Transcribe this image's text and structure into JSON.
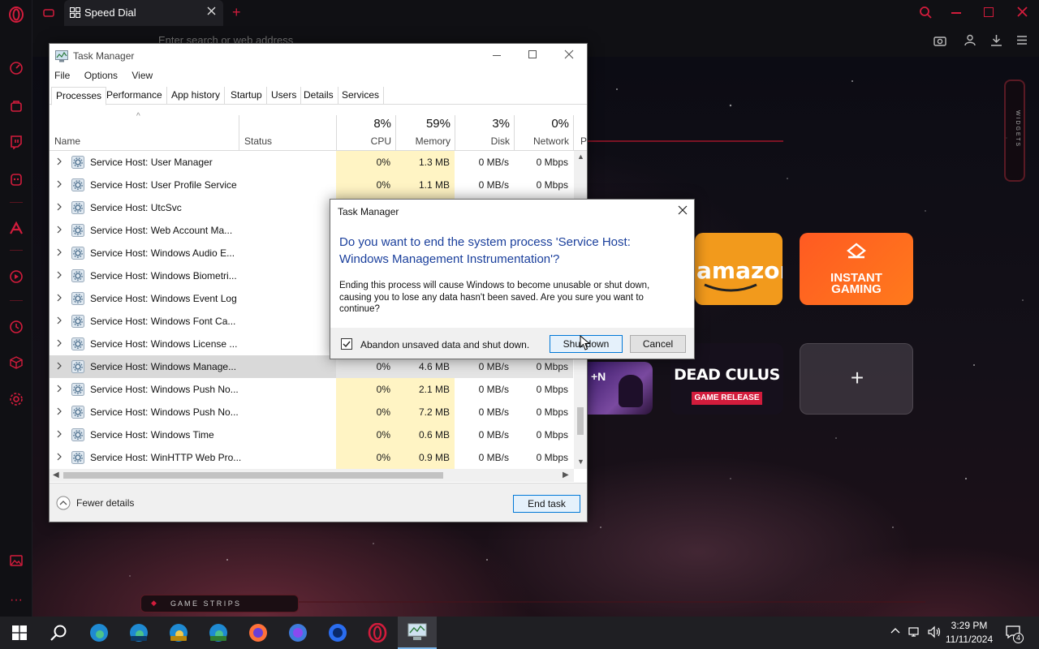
{
  "browser": {
    "tab_title": "Speed Dial",
    "address_placeholder": "Enter search or web address",
    "widgets_label": "W I D G E T S",
    "game_strips_label": "G A M E   S T R I P S",
    "accent": "#d21c3c"
  },
  "speed_dial": {
    "tiles": [
      {
        "name": "amazon",
        "label": "amazon"
      },
      {
        "name": "instant-gaming",
        "line1": "INSTANT",
        "line2": "GAMING"
      },
      {
        "name": "genshin",
        "label": "+N"
      },
      {
        "name": "dead-island",
        "title": "DEAD CULUS",
        "badge": "GAME RELEASE"
      },
      {
        "name": "add-site",
        "label": "+"
      }
    ]
  },
  "task_manager": {
    "title": "Task Manager",
    "menu": [
      "File",
      "Options",
      "View"
    ],
    "tabs": [
      "Processes",
      "Performance",
      "App history",
      "Startup",
      "Users",
      "Details",
      "Services"
    ],
    "active_tab": "Processes",
    "columns": {
      "name": "Name",
      "status": "Status",
      "cpu": {
        "pct": "8%",
        "label": "CPU"
      },
      "memory": {
        "pct": "59%",
        "label": "Memory"
      },
      "disk": {
        "pct": "3%",
        "label": "Disk"
      },
      "network": {
        "pct": "0%",
        "label": "Network"
      },
      "power": "P"
    },
    "rows": [
      {
        "name": "Service Host: User Manager",
        "cpu": "0%",
        "mem": "1.3 MB",
        "disk": "0 MB/s",
        "net": "0 Mbps"
      },
      {
        "name": "Service Host: User Profile Service",
        "cpu": "0%",
        "mem": "1.1 MB",
        "disk": "0 MB/s",
        "net": "0 Mbps"
      },
      {
        "name": "Service Host: UtcSvc",
        "cpu": "",
        "mem": "",
        "disk": "",
        "net": ""
      },
      {
        "name": "Service Host: Web Account Ma...",
        "cpu": "",
        "mem": "",
        "disk": "",
        "net": ""
      },
      {
        "name": "Service Host: Windows Audio E...",
        "cpu": "",
        "mem": "",
        "disk": "",
        "net": ""
      },
      {
        "name": "Service Host: Windows Biometri...",
        "cpu": "",
        "mem": "",
        "disk": "",
        "net": ""
      },
      {
        "name": "Service Host: Windows Event Log",
        "cpu": "",
        "mem": "",
        "disk": "",
        "net": ""
      },
      {
        "name": "Service Host: Windows Font Ca...",
        "cpu": "",
        "mem": "",
        "disk": "",
        "net": ""
      },
      {
        "name": "Service Host: Windows License ...",
        "cpu": "",
        "mem": "",
        "disk": "",
        "net": ""
      },
      {
        "name": "Service Host: Windows Manage...",
        "cpu": "0%",
        "mem": "4.6 MB",
        "disk": "0 MB/s",
        "net": "0 Mbps",
        "selected": true
      },
      {
        "name": "Service Host: Windows Push No...",
        "cpu": "0%",
        "mem": "2.1 MB",
        "disk": "0 MB/s",
        "net": "0 Mbps"
      },
      {
        "name": "Service Host: Windows Push No...",
        "cpu": "0%",
        "mem": "7.2 MB",
        "disk": "0 MB/s",
        "net": "0 Mbps"
      },
      {
        "name": "Service Host: Windows Time",
        "cpu": "0%",
        "mem": "0.6 MB",
        "disk": "0 MB/s",
        "net": "0 Mbps"
      },
      {
        "name": "Service Host: WinHTTP Web Pro...",
        "cpu": "0%",
        "mem": "0.9 MB",
        "disk": "0 MB/s",
        "net": "0 Mbps"
      }
    ],
    "fewer_details": "Fewer details",
    "end_task": "End task"
  },
  "dialog": {
    "title": "Task Manager",
    "question": "Do you want to end the system process 'Service Host: Windows Management Instrumentation'?",
    "message": "Ending this process will cause Windows to become unusable or shut down, causing you to lose any data hasn't been saved. Are you sure you want to continue?",
    "checkbox_label": "Abandon unsaved data and shut down.",
    "checkbox_checked": true,
    "primary_button": "Shut down",
    "cancel_button": "Cancel",
    "question_color": "#1a3f9c"
  },
  "taskbar": {
    "apps": [
      "windows-start",
      "search",
      "edge",
      "edge-beta",
      "edge-canary",
      "edge-dev",
      "firefox",
      "firefox-dev",
      "firefox-nightly",
      "opera-gx",
      "task-manager"
    ],
    "time": "3:29 PM",
    "date": "11/11/2024",
    "notification_count": "4"
  }
}
